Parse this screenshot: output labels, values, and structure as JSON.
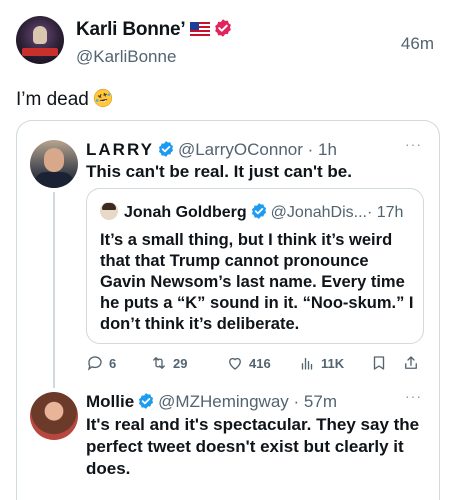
{
  "post": {
    "author_name": "Karli Bonne’",
    "author_handle": "@KarliBonne",
    "time": "46m",
    "text": "I’m dead",
    "emoji": "rolling-on-floor-laughing-emoji",
    "flag": "us-flag-icon"
  },
  "quoted": {
    "author_name": "LARRY",
    "author_handle": "@LarryOConnor",
    "time": "· 1h",
    "text": "This can't be real.  It just can't be.",
    "more": "···",
    "nested": {
      "author_name": "Jonah Goldberg",
      "author_handle": "@JonahDis...",
      "time": "· 17h",
      "text": "It’s a small thing, but I think it’s weird that that Trump cannot pronounce Gavin Newsom’s last name. Every time he puts a “K” sound in it. “Noo-skum.” I don’t think it’s deliberate."
    },
    "actions": {
      "replies": "6",
      "reposts": "29",
      "likes": "416",
      "views": "11K"
    }
  },
  "reply": {
    "author_name": "Mollie",
    "author_handle": "@MZHemingway",
    "time": "· 57m",
    "text": "It's real and it's spectacular. They say the perfect tweet doesn't exist but clearly it does.",
    "more": "···"
  },
  "colors": {
    "verified_red": "#e0245e",
    "verified_blue": "#1d9bf0",
    "secondary_text": "#536471",
    "border": "#cfd9de"
  }
}
